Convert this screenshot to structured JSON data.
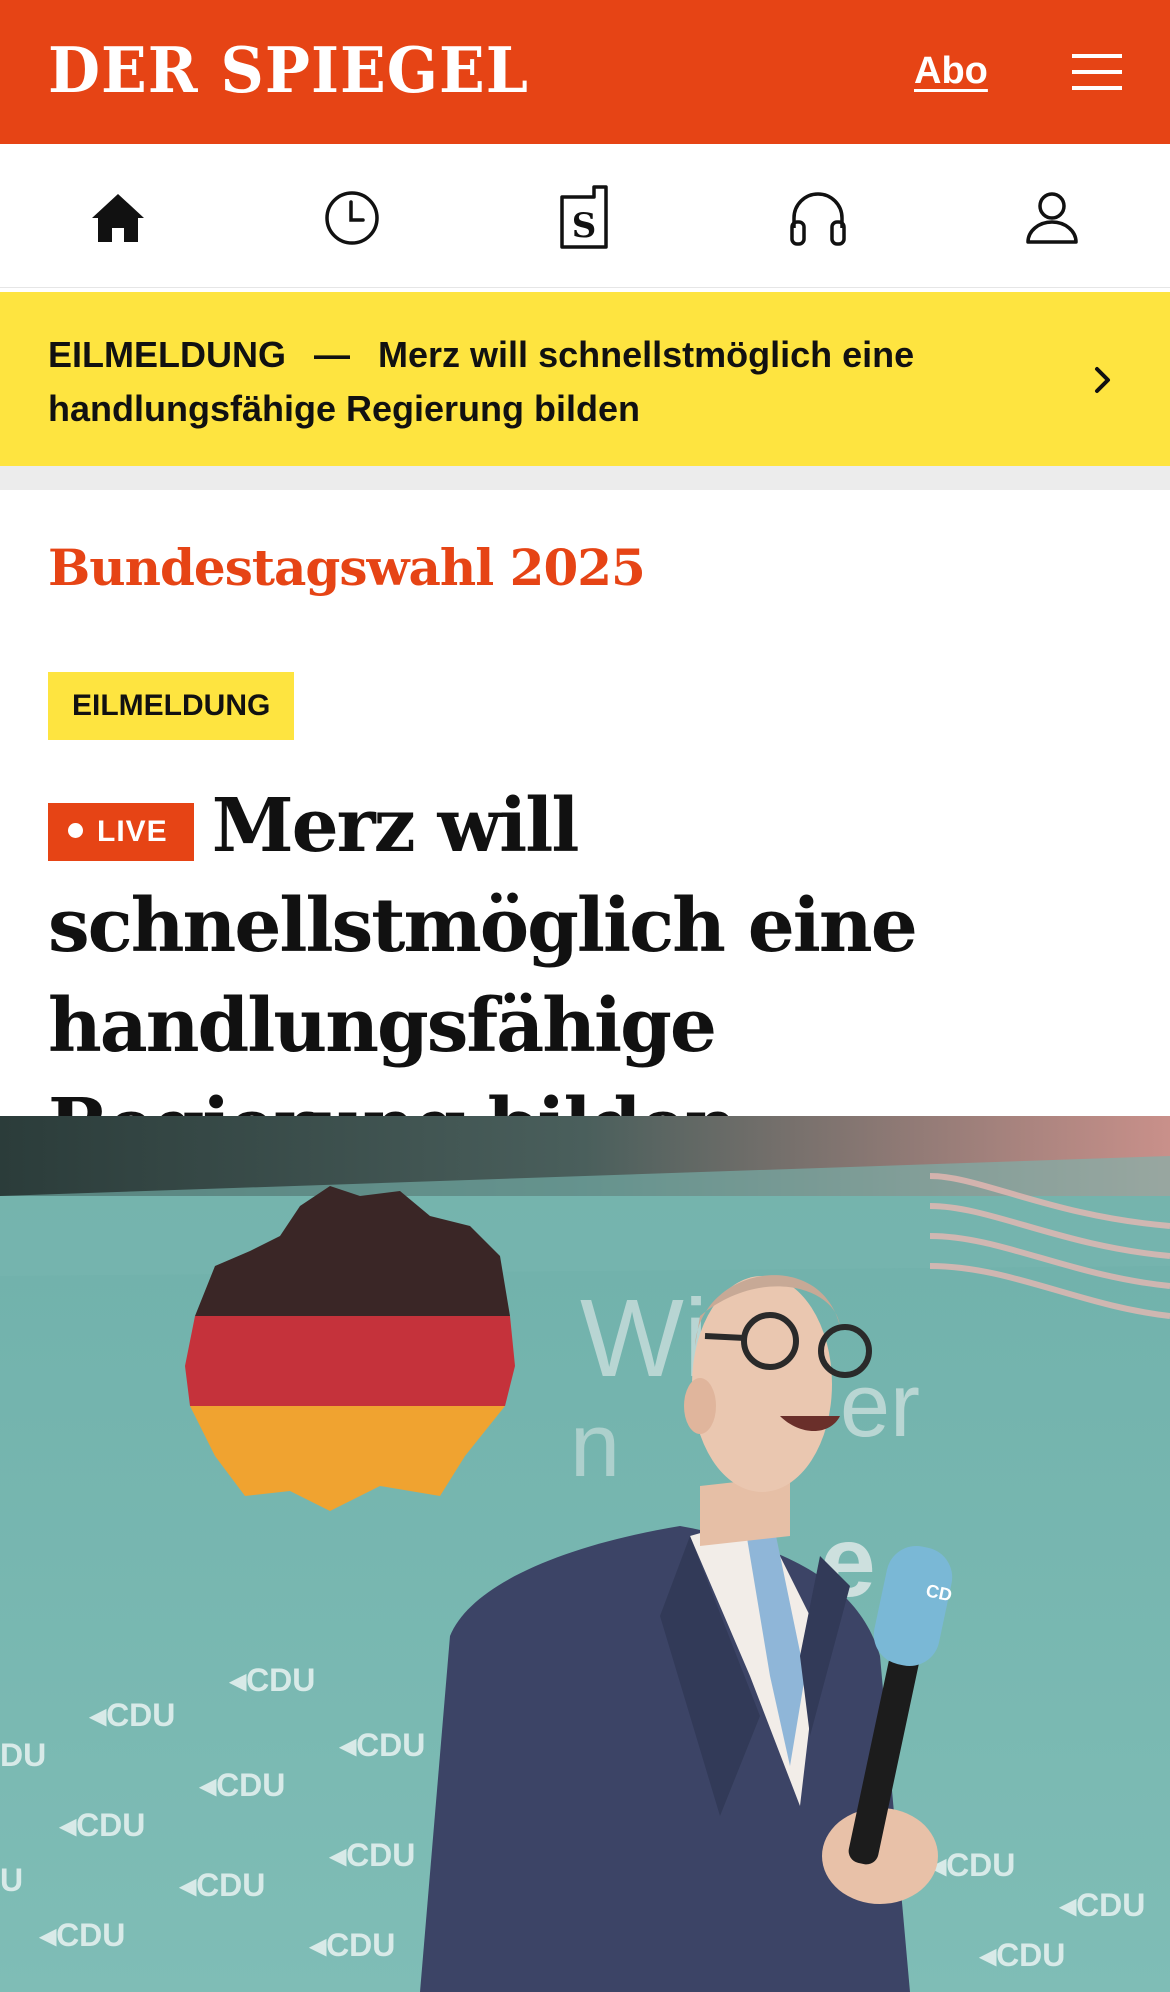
{
  "header": {
    "logo": "DER SPIEGEL",
    "abo_label": "Abo",
    "menu_icon": "hamburger-menu-icon"
  },
  "nav_icons": [
    "home-icon",
    "clock-icon",
    "spiegel-plus-icon",
    "headphones-icon",
    "user-icon"
  ],
  "breaking_banner": {
    "label": "EILMELDUNG",
    "dash": "—",
    "text": "Merz will schnellstmöglich eine handlungsfähige Regierung bilden"
  },
  "article": {
    "kicker": "Bundestagswahl 2025",
    "badge": "EILMELDUNG",
    "live_label": "LIVE",
    "headline": "Merz will schnellstmöglich eine handlungsfähige Regierung bilden"
  },
  "colors": {
    "brand_orange": "#e64415",
    "breaking_yellow": "#fee440",
    "text_dark": "#111111"
  }
}
